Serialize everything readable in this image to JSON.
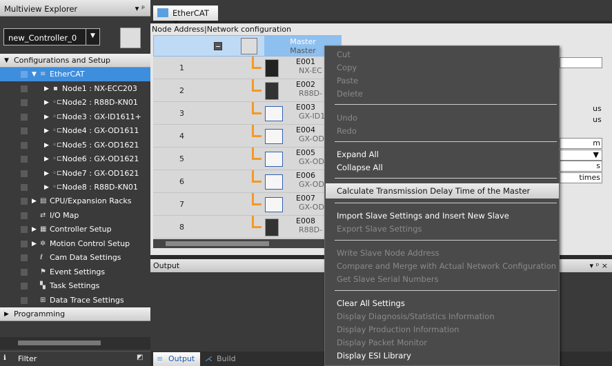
{
  "explorer": {
    "title": "Multiview Explorer",
    "pin": "▾ ᵖ",
    "controller": "new_Controller_0",
    "config_header": "Configurations and Setup",
    "ethercat": "EtherCAT",
    "nodes": [
      "Node1 : NX-ECC203",
      "Node2 : R88D-KN01",
      "Node3 : GX-ID1611+",
      "Node4 : GX-OD1611",
      "Node5 : GX-OD1621",
      "Node6 : GX-OD1621",
      "Node7 : GX-OD1621",
      "Node8 : R88D-KN01"
    ],
    "items": [
      "CPU/Expansion Racks",
      "I/O Map",
      "Controller Setup",
      "Motion Control Setup",
      "Cam Data Settings",
      "Event Settings",
      "Task Settings",
      "Data Trace Settings"
    ],
    "programming": "Programming",
    "filter": "Filter"
  },
  "editor": {
    "tab": "EtherCAT",
    "tab_close": "×",
    "header": "Node Address|Network configuration",
    "master_label_1": "Master",
    "master_label_2": "Master",
    "rows": [
      {
        "num": "1",
        "name": "E001",
        "model": "NX-EC"
      },
      {
        "num": "2",
        "name": "E002",
        "model": "R88D-"
      },
      {
        "num": "3",
        "name": "E003",
        "model": "GX-ID1"
      },
      {
        "num": "4",
        "name": "E004",
        "model": "GX-OD"
      },
      {
        "num": "5",
        "name": "E005",
        "model": "GX-OD"
      },
      {
        "num": "6",
        "name": "E006",
        "model": "GX-OD"
      },
      {
        "num": "7",
        "name": "E007",
        "model": "GX-OD"
      },
      {
        "num": "8",
        "name": "E008",
        "model": "R88D-"
      }
    ]
  },
  "props": {
    "us1": "us",
    "us2": "us",
    "m": "m",
    "s": "s",
    "times": "times"
  },
  "output": {
    "title": "Output",
    "pin": "▾ ᵖ ×",
    "tab_output": "Output",
    "tab_build": "Build"
  },
  "menu": {
    "cut": "Cut",
    "copy": "Copy",
    "paste": "Paste",
    "delete": "Delete",
    "undo": "Undo",
    "redo": "Redo",
    "expand_all": "Expand All",
    "collapse_all": "Collapse All",
    "calc_delay": "Calculate Transmission Delay Time of the Master",
    "import_slave": "Import Slave Settings and Insert New Slave",
    "export_slave": "Export Slave Settings",
    "write_addr": "Write Slave Node Address",
    "compare_merge": "Compare and Merge with Actual Network Configuration",
    "get_serial": "Get Slave Serial Numbers",
    "clear_all": "Clear All Settings",
    "diag": "Display Diagnosis/Statistics Information",
    "production": "Display Production Information",
    "packet": "Display Packet Monitor",
    "esi": "Display ESI Library"
  },
  "colors": {
    "selection": "#3e8ede",
    "connector": "#f29a24",
    "menu_bg": "#4a4a4a"
  }
}
